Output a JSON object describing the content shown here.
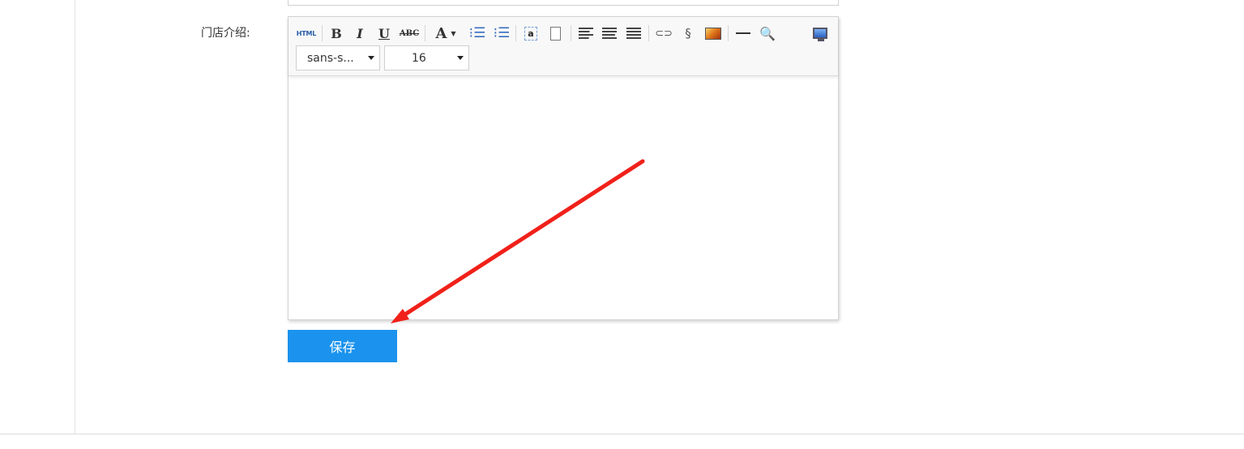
{
  "form": {
    "intro_label": "门店介绍:",
    "save_label": "保存"
  },
  "editor": {
    "toolbar": {
      "html_label": "HTML",
      "bold_label": "B",
      "italic_label": "I",
      "underline_label": "U",
      "strike_label": "ABC",
      "fontcolor_label": "A",
      "font_family_value": "sans-s...",
      "font_size_value": "16",
      "icons": [
        "html-icon",
        "bold-icon",
        "italic-icon",
        "underline-icon",
        "strikethrough-icon",
        "font-color-icon",
        "ordered-list-icon",
        "unordered-list-icon",
        "special-char-icon",
        "blank-page-icon",
        "align-left-icon",
        "align-center-icon",
        "align-right-icon",
        "link-icon",
        "unlink-icon",
        "image-icon",
        "horizontal-rule-icon",
        "preview-icon",
        "fullscreen-icon"
      ]
    },
    "content": ""
  },
  "annotation": {
    "arrow_color": "#f0211a"
  },
  "colors": {
    "save_button": "#1b93ee",
    "toolbar_bg": "#f8f8f8"
  }
}
